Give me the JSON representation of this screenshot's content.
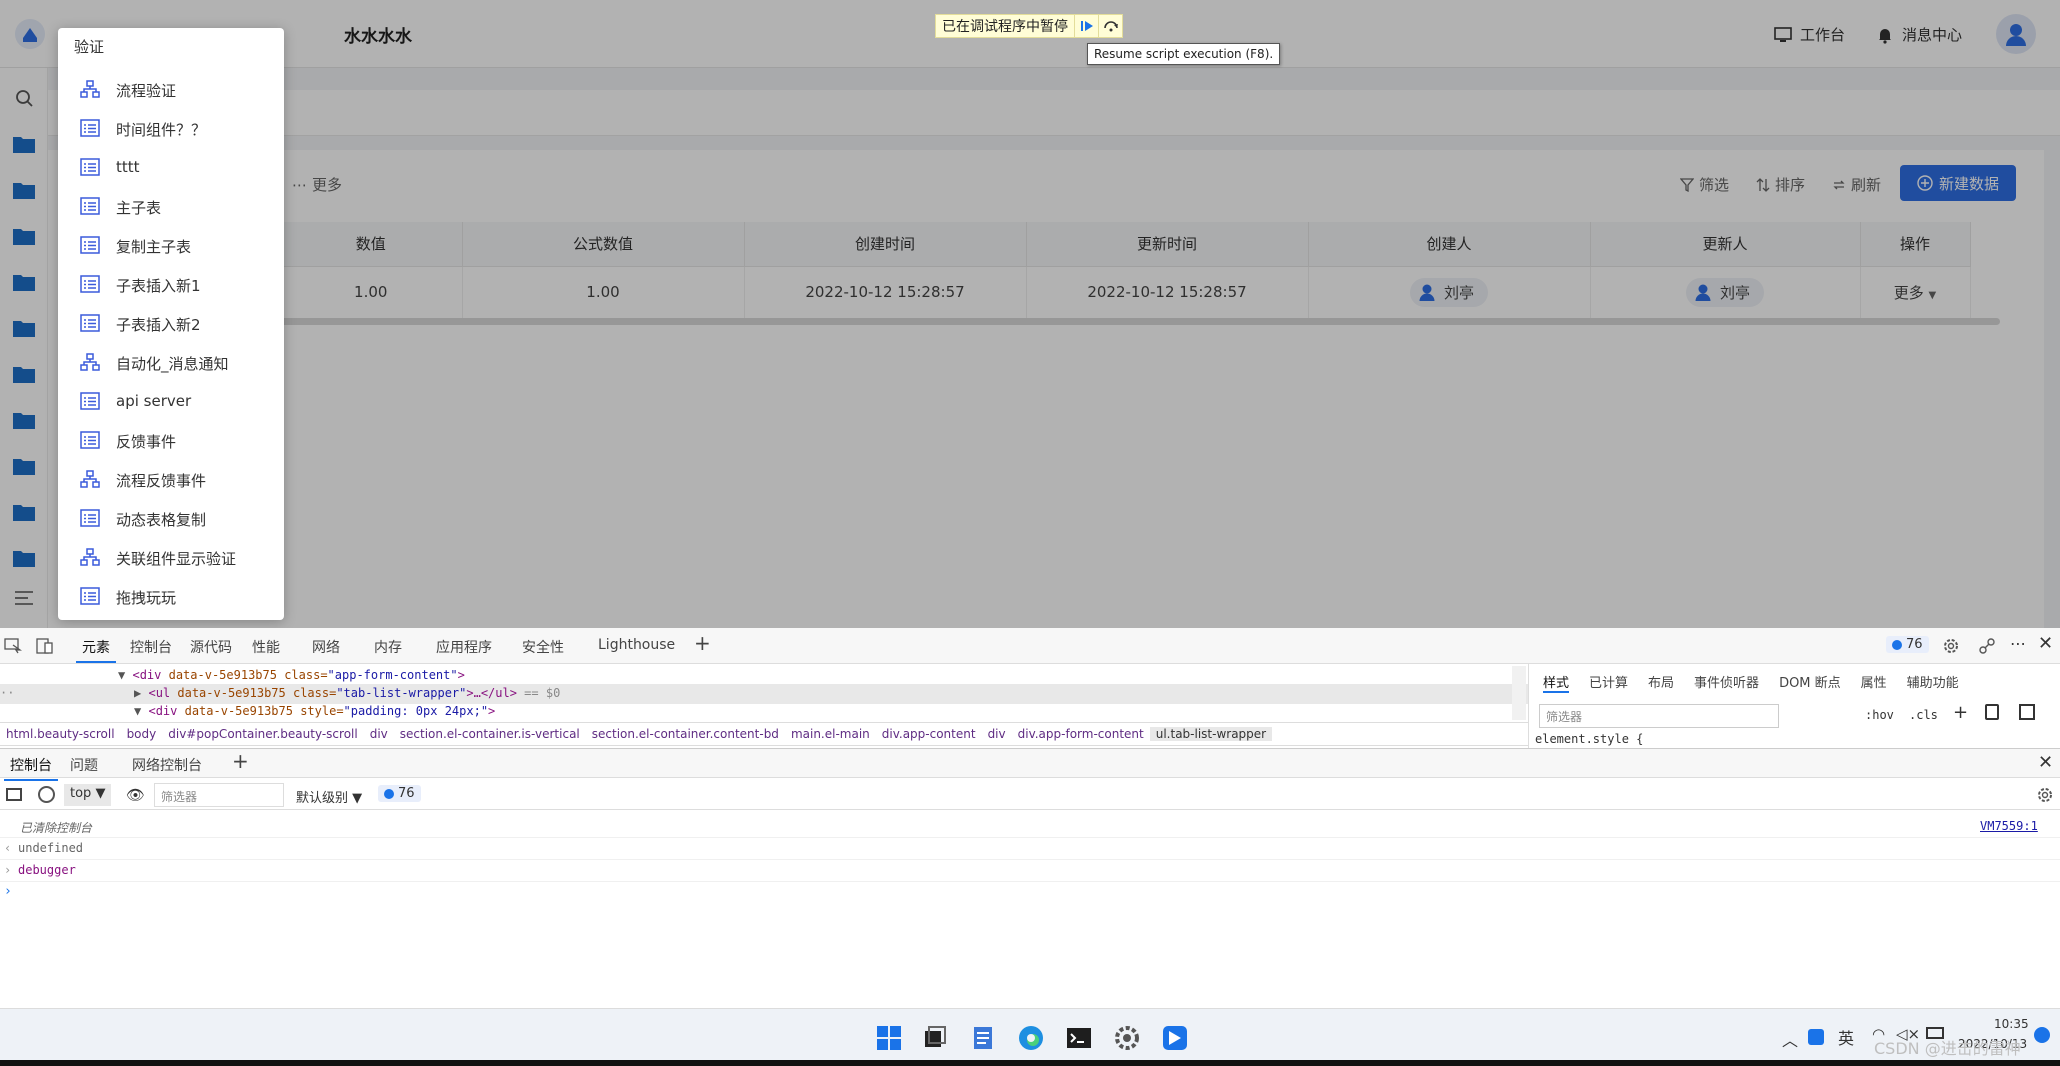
{
  "header": {
    "app_title": "水水水水",
    "workbench": "工作台",
    "messages": "消息中心"
  },
  "debugger": {
    "paused_message": "已在调试程序中暂停",
    "tooltip": "Resume script execution (F8)."
  },
  "toolbar": {
    "more": "更多",
    "filter": "筛选",
    "sort": "排序",
    "refresh": "刷新",
    "new_data": "新建数据"
  },
  "table": {
    "headers": [
      "数值",
      "公式数值",
      "创建时间",
      "更新时间",
      "创建人",
      "更新人",
      "操作"
    ],
    "row": {
      "value": "1.00",
      "formula_value": "1.00",
      "created_at": "2022-10-12 15:28:57",
      "updated_at": "2022-10-12 15:28:57",
      "creator": "刘亭",
      "updater": "刘亭",
      "action": "更多"
    }
  },
  "menu": {
    "title": "验证",
    "items": [
      {
        "label": "流程验证",
        "icon": "flow-icon"
      },
      {
        "label": "时间组件？？",
        "icon": "form-icon"
      },
      {
        "label": "tttt",
        "icon": "form-icon"
      },
      {
        "label": "主子表",
        "icon": "form-icon"
      },
      {
        "label": "复制主子表",
        "icon": "form-icon"
      },
      {
        "label": "子表插入新1",
        "icon": "form-icon"
      },
      {
        "label": "子表插入新2",
        "icon": "form-icon"
      },
      {
        "label": "自动化_消息通知",
        "icon": "flow-icon"
      },
      {
        "label": "api server",
        "icon": "form-icon"
      },
      {
        "label": "反馈事件",
        "icon": "form-icon"
      },
      {
        "label": "流程反馈事件",
        "icon": "flow-icon"
      },
      {
        "label": "动态表格复制",
        "icon": "form-icon"
      },
      {
        "label": "关联组件显示验证",
        "icon": "flow-icon"
      },
      {
        "label": "拖拽玩玩",
        "icon": "form-icon"
      }
    ]
  },
  "devtools": {
    "tabs": [
      "元素",
      "控制台",
      "源代码",
      "性能",
      "网络",
      "内存",
      "应用程序",
      "安全性",
      "Lighthouse"
    ],
    "issue_count": "76",
    "code_lines": {
      "line1_tag": "<div",
      "line1_attrs": " data-v-5e913b75 class=",
      "line1_val": "\"app-form-content\"",
      "line1_end": ">",
      "line2_tag": "<ul",
      "line2_attrs": " data-v-5e913b75 class=",
      "line2_val": "\"tab-list-wrapper\"",
      "line2_end": ">…</ul>",
      "line2_eq": " == $0",
      "line3_tag": "<div",
      "line3_attrs": " data-v-5e913b75 style=",
      "line3_val": "\"padding: 0px 24px;\"",
      "line3_end": ">"
    },
    "breadcrumbs": [
      "html.beauty-scroll",
      "body",
      "div#popContainer.beauty-scroll",
      "div",
      "section.el-container.is-vertical",
      "section.el-container.content-bd",
      "main.el-main",
      "div.app-content",
      "div",
      "div.app-form-content",
      "ul.tab-list-wrapper"
    ],
    "styles_tabs": [
      "样式",
      "已计算",
      "布局",
      "事件侦听器",
      "DOM 断点",
      "属性",
      "辅助功能"
    ],
    "styles_filter_placeholder": "筛选器",
    "hov": ":hov",
    "cls": ".cls",
    "element_style": "element.style {",
    "drawer_tabs": [
      "控制台",
      "问题",
      "网络控制台"
    ],
    "context": "top",
    "console_filter_placeholder": "筛选器",
    "levels": "默认级别",
    "console_count": "76",
    "console_lines": {
      "cleared": "已清除控制台",
      "cleared_src": "VM7559:1",
      "undefined": "undefined",
      "debugger": "debugger"
    }
  },
  "taskbar": {
    "ime": "英",
    "time": "10:35",
    "date": "2022/10/13",
    "watermark": "CSDN @进击的雷神"
  },
  "colors": {
    "primary": "#2f6fe4",
    "menu_icon": "#3b5bdb",
    "overlay": "rgba(0,0,0,0.30)"
  }
}
